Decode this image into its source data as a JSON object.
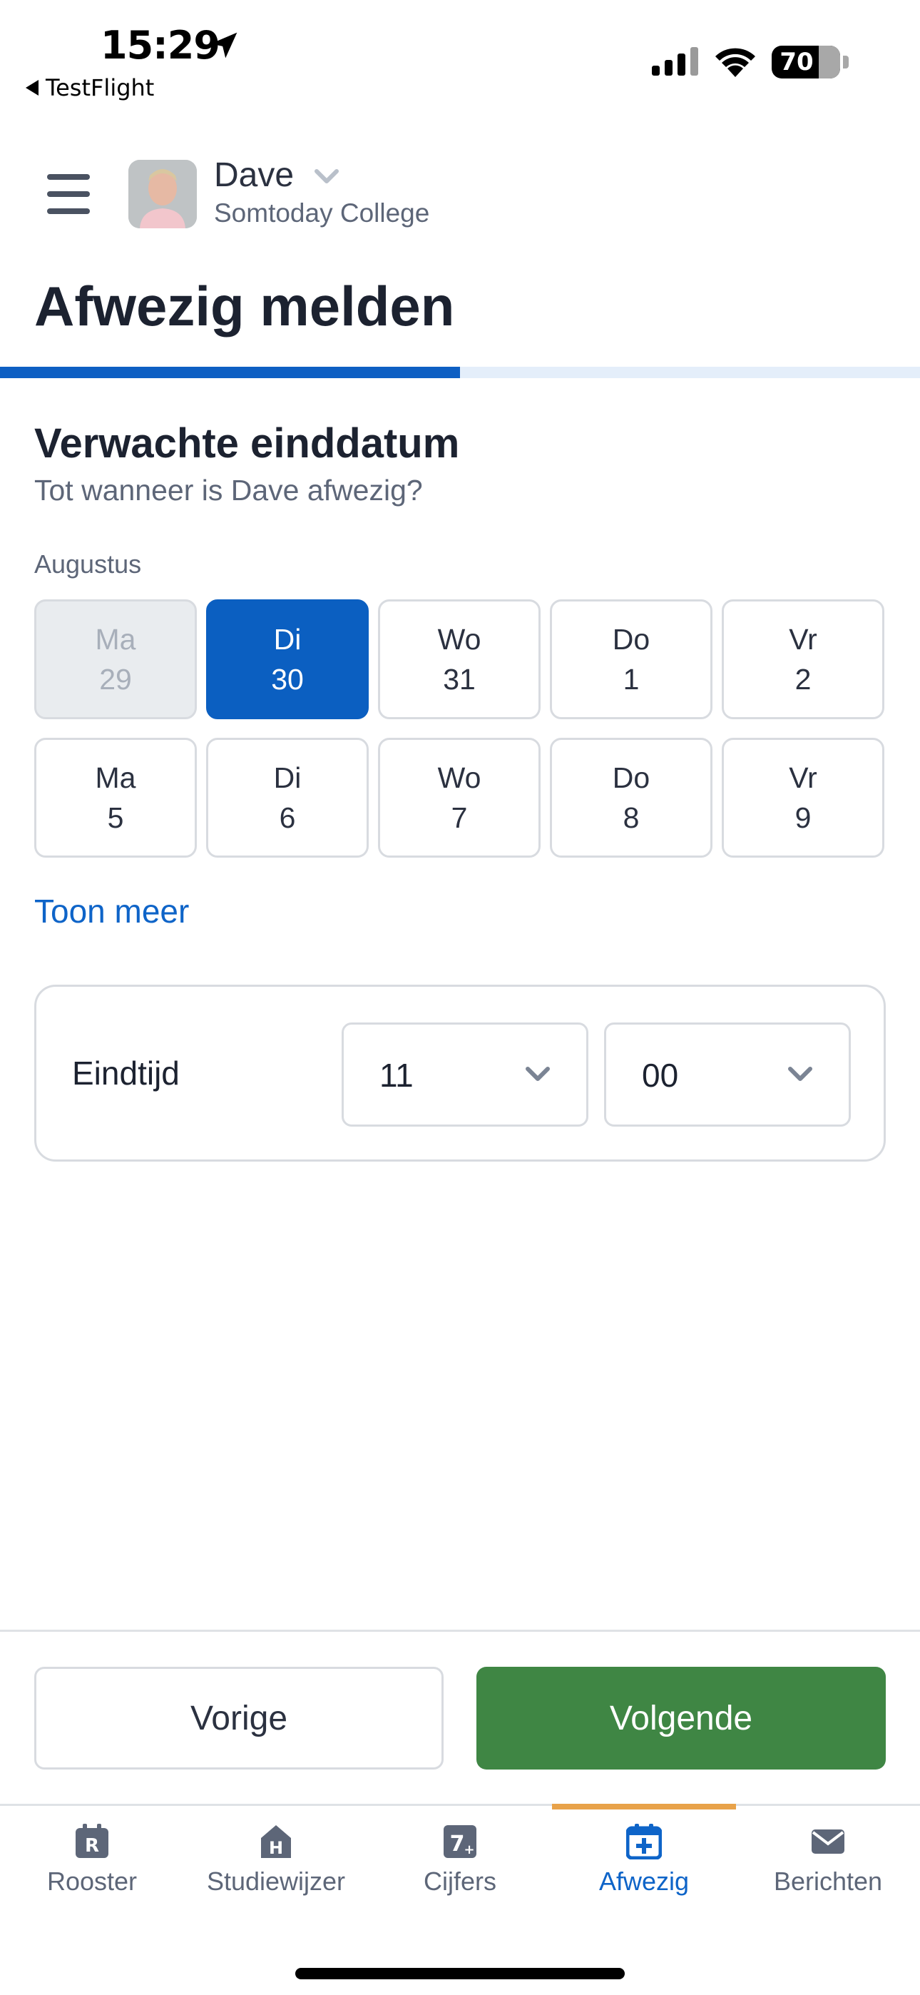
{
  "status_bar": {
    "time": "15:29",
    "back_app": "TestFlight",
    "battery": "70"
  },
  "header": {
    "user_name": "Dave",
    "school": "Somtoday College"
  },
  "page_title": "Afwezig melden",
  "progress": 0.5,
  "section": {
    "title": "Verwachte einddatum",
    "subtitle": "Tot wanneer is Dave afwezig?",
    "month": "Augustus"
  },
  "days": [
    [
      {
        "day": "Ma",
        "date": "29",
        "state": "disabled"
      },
      {
        "day": "Di",
        "date": "30",
        "state": "selected"
      },
      {
        "day": "Wo",
        "date": "31",
        "state": "normal"
      },
      {
        "day": "Do",
        "date": "1",
        "state": "normal"
      },
      {
        "day": "Vr",
        "date": "2",
        "state": "normal"
      }
    ],
    [
      {
        "day": "Ma",
        "date": "5",
        "state": "normal"
      },
      {
        "day": "Di",
        "date": "6",
        "state": "normal"
      },
      {
        "day": "Wo",
        "date": "7",
        "state": "normal"
      },
      {
        "day": "Do",
        "date": "8",
        "state": "normal"
      },
      {
        "day": "Vr",
        "date": "9",
        "state": "normal"
      }
    ]
  ],
  "show_more": "Toon meer",
  "end_time": {
    "label": "Eindtijd",
    "hour": "11",
    "minute": "00"
  },
  "buttons": {
    "previous": "Vorige",
    "next": "Volgende"
  },
  "tabs": [
    {
      "label": "Rooster",
      "icon": "rooster-icon"
    },
    {
      "label": "Studiewijzer",
      "icon": "studiewijzer-icon"
    },
    {
      "label": "Cijfers",
      "icon": "cijfers-icon"
    },
    {
      "label": "Afwezig",
      "icon": "afwezig-icon",
      "active": true
    },
    {
      "label": "Berichten",
      "icon": "envelope-icon"
    }
  ],
  "colors": {
    "primary": "#0b5fc1",
    "success": "#3f8644",
    "tab_indicator": "#e8a24a"
  }
}
